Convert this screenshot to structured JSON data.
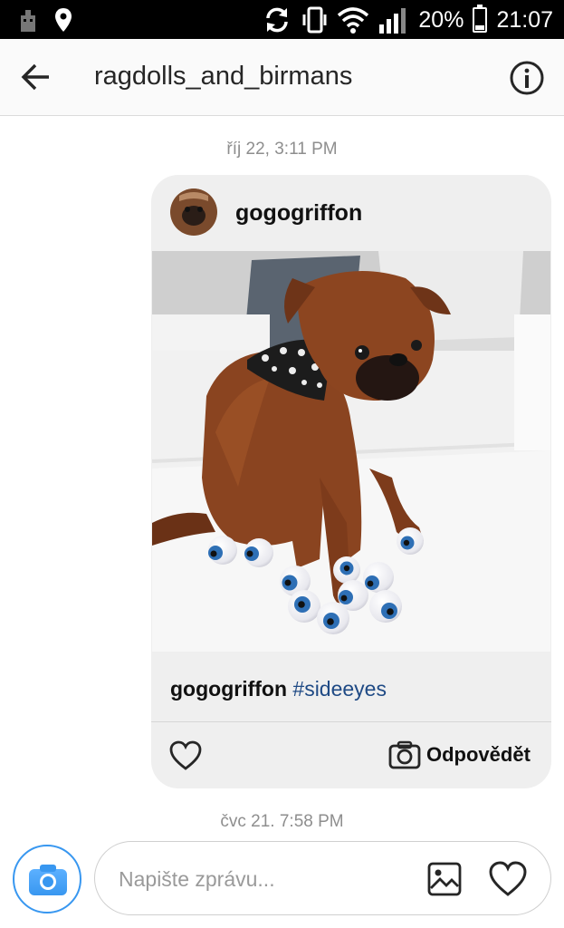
{
  "status_bar": {
    "battery": "20%",
    "time": "21:07",
    "icons": [
      "building-icon",
      "location-icon",
      "sync-icon",
      "vibrate-icon",
      "wifi-icon",
      "signal-icon",
      "battery-icon"
    ]
  },
  "header": {
    "title": "ragdolls_and_birmans",
    "icons": {
      "back": "arrow-left-icon",
      "info": "info-icon"
    }
  },
  "thread": {
    "timestamp_top": "říj 22, 3:11 PM",
    "shared_post": {
      "author": "gogogriffon",
      "caption_user": "gogogriffon",
      "caption_tag": "#sideeyes",
      "reply_label": "Odpovědět"
    },
    "timestamp_bottom": "čvc 21. 7:58 PM"
  },
  "composer": {
    "placeholder": "Napište zprávu...",
    "value": ""
  },
  "colors": {
    "accent": "#3897f0",
    "hashtag": "#1f4a85",
    "status_bar": "#000000",
    "header_bg": "#fafafa",
    "bubble_bg": "#efefef"
  }
}
